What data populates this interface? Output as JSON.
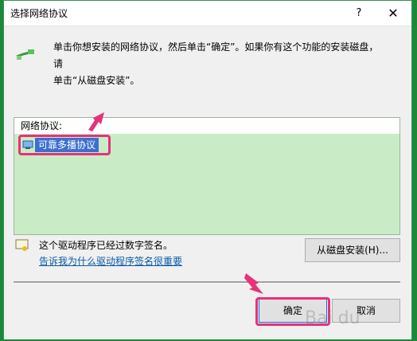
{
  "window": {
    "title": "选择网络协议",
    "help_label": "?",
    "close_label": "✕"
  },
  "description": "单击你想安装的网络协议，然后单击“确定”。如果你有这个功能的安装磁盘，请\n单击“从磁盘安装”。",
  "list": {
    "header": "网络协议:",
    "items": [
      {
        "label": "可靠多播协议",
        "selected": true
      }
    ]
  },
  "signature": {
    "text": "这个驱动程序已经过数字签名。",
    "link": "告诉我为什么驱动程序签名很重要"
  },
  "buttons": {
    "have_disk": "从磁盘安装(H)...",
    "ok": "确定",
    "cancel": "取消"
  },
  "watermark": "Bai du",
  "colors": {
    "highlight": "#e8317a",
    "selection": "#3d6fcf",
    "list_bg": "#c9ecc6"
  }
}
